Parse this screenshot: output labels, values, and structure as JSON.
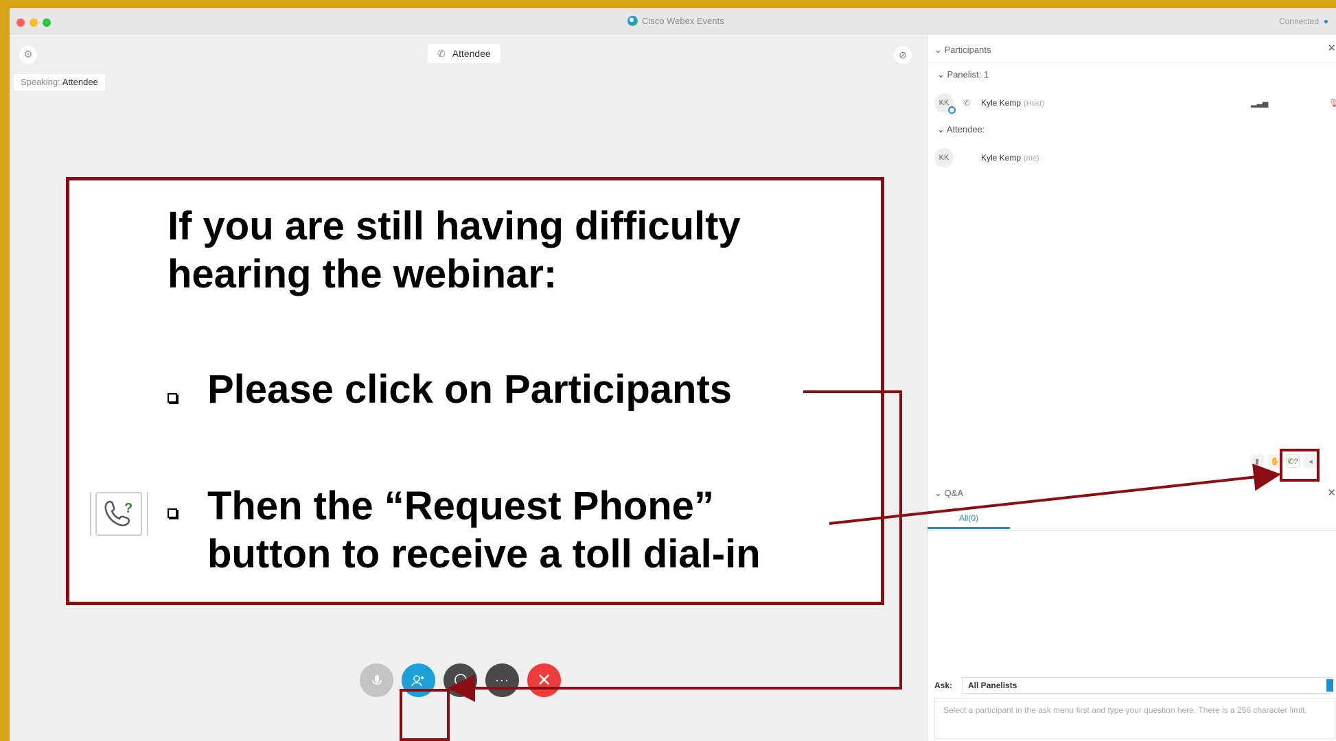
{
  "window": {
    "title": "Cisco Webex Events",
    "status": "Connected"
  },
  "stage": {
    "attendee_label": "Attendee",
    "speaking_label": "Speaking:",
    "speaking_name": "Attendee"
  },
  "participants_panel": {
    "title": "Participants",
    "panelist_group": "Panelist: 1",
    "attendee_group": "Attendee:",
    "rows": [
      {
        "initials": "KK",
        "name": "Kyle Kemp",
        "role": "(Host)"
      },
      {
        "initials": "KK",
        "name": "Kyle Kemp",
        "role": "(me)"
      }
    ]
  },
  "qa_panel": {
    "title": "Q&A",
    "tab_all": "All(0)",
    "ask_label": "Ask:",
    "ask_value": "All Panelists",
    "ask_placeholder": "Select a participant in the ask menu first and type your question here. There is a 256 character limit."
  },
  "callout": {
    "heading": "If you are still having difficulty hearing the webinar:",
    "bullet_1": "Please click on Participants",
    "bullet_2_line_1": "Then the “Request Phone”",
    "bullet_2_line_2": "button to receive a toll dial-in"
  },
  "icons": {
    "close": "close-icon",
    "gear": "gear-icon",
    "phone": "phone-icon",
    "request_phone": "request-phone-icon"
  },
  "colors": {
    "frame": "#d8a417",
    "callout_border": "#8b0f12",
    "accent": "#1a8ed8",
    "end_call": "#ef3b3b"
  }
}
